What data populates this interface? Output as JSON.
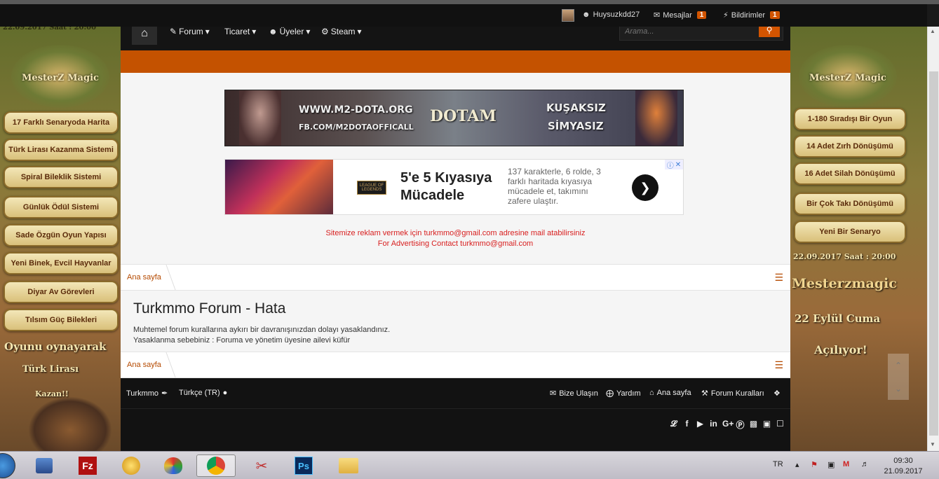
{
  "userbar": {
    "username": "Huysuzkdd27",
    "messages_label": "Mesajlar",
    "messages_count": "1",
    "alerts_label": "Bildirimler",
    "alerts_count": "1"
  },
  "nav": {
    "items": [
      {
        "label": "Forum"
      },
      {
        "label": "Ticaret"
      },
      {
        "label": "Üyeler"
      },
      {
        "label": "Steam"
      }
    ],
    "search_placeholder": "Arama..."
  },
  "left_ad": {
    "top_text": "22.09.2017 Saat : 20:00",
    "logo_text": "MesterZ Magic",
    "buttons": [
      "17 Farklı Senaryoda Harita",
      "Türk Lirası Kazanma Sistemi",
      "Spiral Bileklik Sistemi",
      "Günlük Ödül Sistemi",
      "Sade Özgün Oyun Yapısı",
      "Yeni Binek, Evcil Hayvanlar",
      "Diyar Av Görevleri",
      "Tılsım Güç Bilekleri"
    ],
    "promo_line1": "Oyunu oynayarak",
    "promo_line2": "Türk Lirası",
    "promo_line3": "Kazan!!"
  },
  "right_ad": {
    "logo_text": "MesterZ Magic",
    "buttons": [
      "1-180 Sıradışı Bir Oyun",
      "14 Adet Zırh Dönüşümü",
      "16 Adet Silah Dönüşümü",
      "Bir Çok Takı Dönüşümü",
      "Yeni Bir Senaryo"
    ],
    "date_text": "22.09.2017 Saat : 20:00",
    "brand_text": "Mesterzmagic",
    "day_text": "22 Eylül Cuma",
    "open_text": "Açılıyor!"
  },
  "banner1": {
    "url": "WWW.M2-DOTA.ORG",
    "fb": "FB.COM/M2DOTAOFFICALL",
    "logo": "DOTAM",
    "slogan1": "KUŞAKSIZ",
    "slogan2": "SİMYASIZ"
  },
  "banner2": {
    "brand": "LEAGUE OF LEGENDS",
    "headline": "5'e 5 Kıyasıya Mücadele",
    "description": "137 karakterle, 6 rolde, 3 farklı haritada kıyasıya mücadele et, takımını zafere ulaştır."
  },
  "ad_contact": {
    "line1": "Sitemize reklam vermek için turkmmo@gmail.com adresine mail atabilirsiniz",
    "line2": "For Advertising Contact turkmmo@gmail.com"
  },
  "breadcrumb": {
    "home": "Ana sayfa"
  },
  "error": {
    "title": "Turkmmo Forum - Hata",
    "line1": "Muhtemel forum kurallarına aykırı bir davranışınızdan dolayı yasaklandınız.",
    "line2": "Yasaklanma sebebiniz : Foruma ve yönetim üyesine ailevi küfür"
  },
  "footer": {
    "style_label": "Turkmmo",
    "language_label": "Türkçe (TR)",
    "contact_label": "Bize Ulaşın",
    "help_label": "Yardım",
    "home_label": "Ana sayfa",
    "rules_label": "Forum Kuralları"
  },
  "taskbar": {
    "language": "TR",
    "time": "09:30",
    "date": "21.09.2017"
  },
  "colors": {
    "accent": "#c45200",
    "badge": "#d25400",
    "link": "#b54a00",
    "ad_text": "#d82020"
  }
}
